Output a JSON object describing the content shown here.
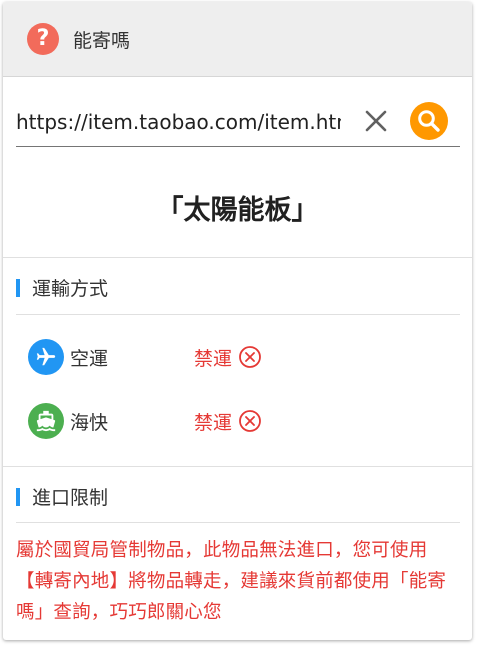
{
  "app": {
    "title": "能寄嗎"
  },
  "search": {
    "url_value": "https://item.taobao.com/item.htm"
  },
  "product": {
    "title": "「太陽能板」"
  },
  "shipping": {
    "section_title": "運輸方式",
    "methods": [
      {
        "label": "空運",
        "status": "禁運",
        "icon": "airplane-icon",
        "color": "#2196f3"
      },
      {
        "label": "海快",
        "status": "禁運",
        "icon": "ship-icon",
        "color": "#4caf50"
      }
    ]
  },
  "import": {
    "section_title": "進口限制",
    "notice": "屬於國貿局管制物品，此物品無法進口，您可使用【轉寄內地】將物品轉走，建議來貨前都使用「能寄嗎」查詢，巧巧郎關心您"
  },
  "colors": {
    "accent_blue": "#2196f3",
    "search_orange": "#ff9800",
    "help_red": "#f26b5b",
    "status_red": "#e53935",
    "ship_green": "#4caf50"
  }
}
